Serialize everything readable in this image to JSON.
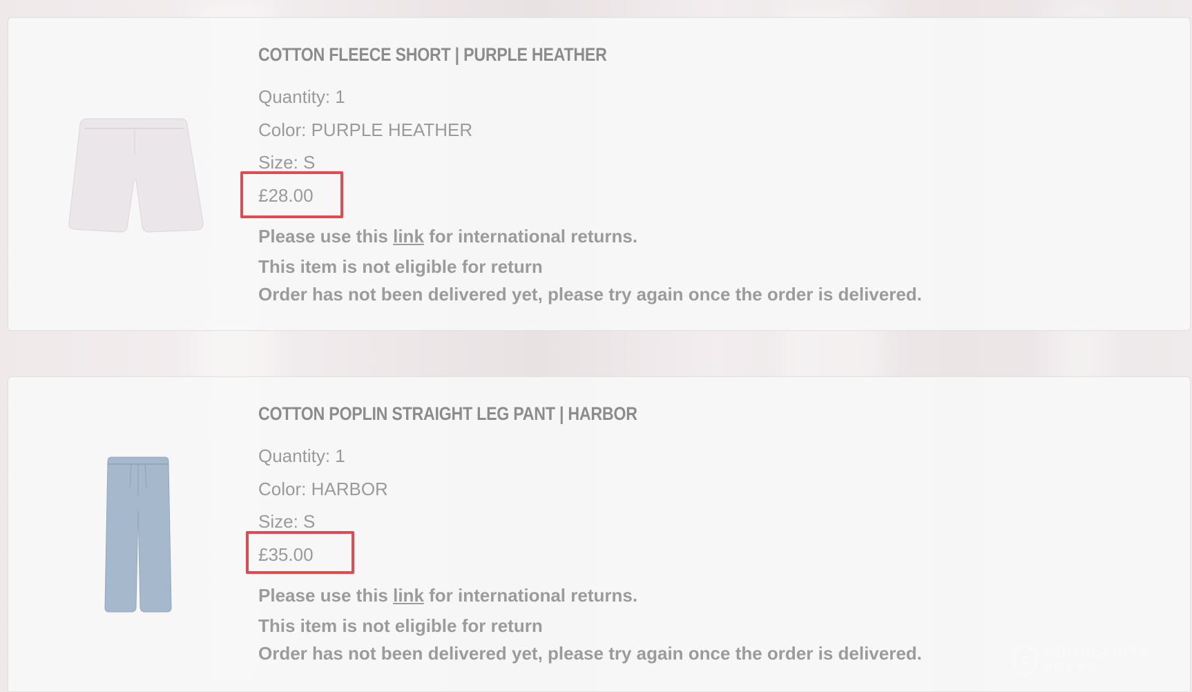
{
  "items": [
    {
      "title": "COTTON FLEECE SHORT | PURPLE HEATHER",
      "quantity": "Quantity: 1",
      "color": "Color: PURPLE HEATHER",
      "size": "Size: S",
      "price": "£28.00",
      "intl_prefix": "Please use this ",
      "intl_link": "link",
      "intl_suffix": " for international returns.",
      "not_eligible": "This item is not eligible for return",
      "not_delivered": "Order has not been delivered yet, please try again once the order is delivered.",
      "image": "shorts-lavender",
      "image_color": "#ebe6ea"
    },
    {
      "title": "COTTON POPLIN STRAIGHT LEG PANT | HARBOR",
      "quantity": "Quantity: 1",
      "color": "Color: HARBOR",
      "size": "Size: S",
      "price": "£35.00",
      "intl_prefix": "Please use this ",
      "intl_link": "link",
      "intl_suffix": " for international returns.",
      "not_eligible": "This item is not eligible for return",
      "not_delivered": "Order has not been delivered yet, please try again once the order is delivered.",
      "image": "pants-harbor-blue",
      "image_color": "#a5b8cc"
    }
  ],
  "watermark": {
    "line1": "COMPLAINTS",
    "line2": "BOARD"
  },
  "highlight_color": "#e24a52"
}
